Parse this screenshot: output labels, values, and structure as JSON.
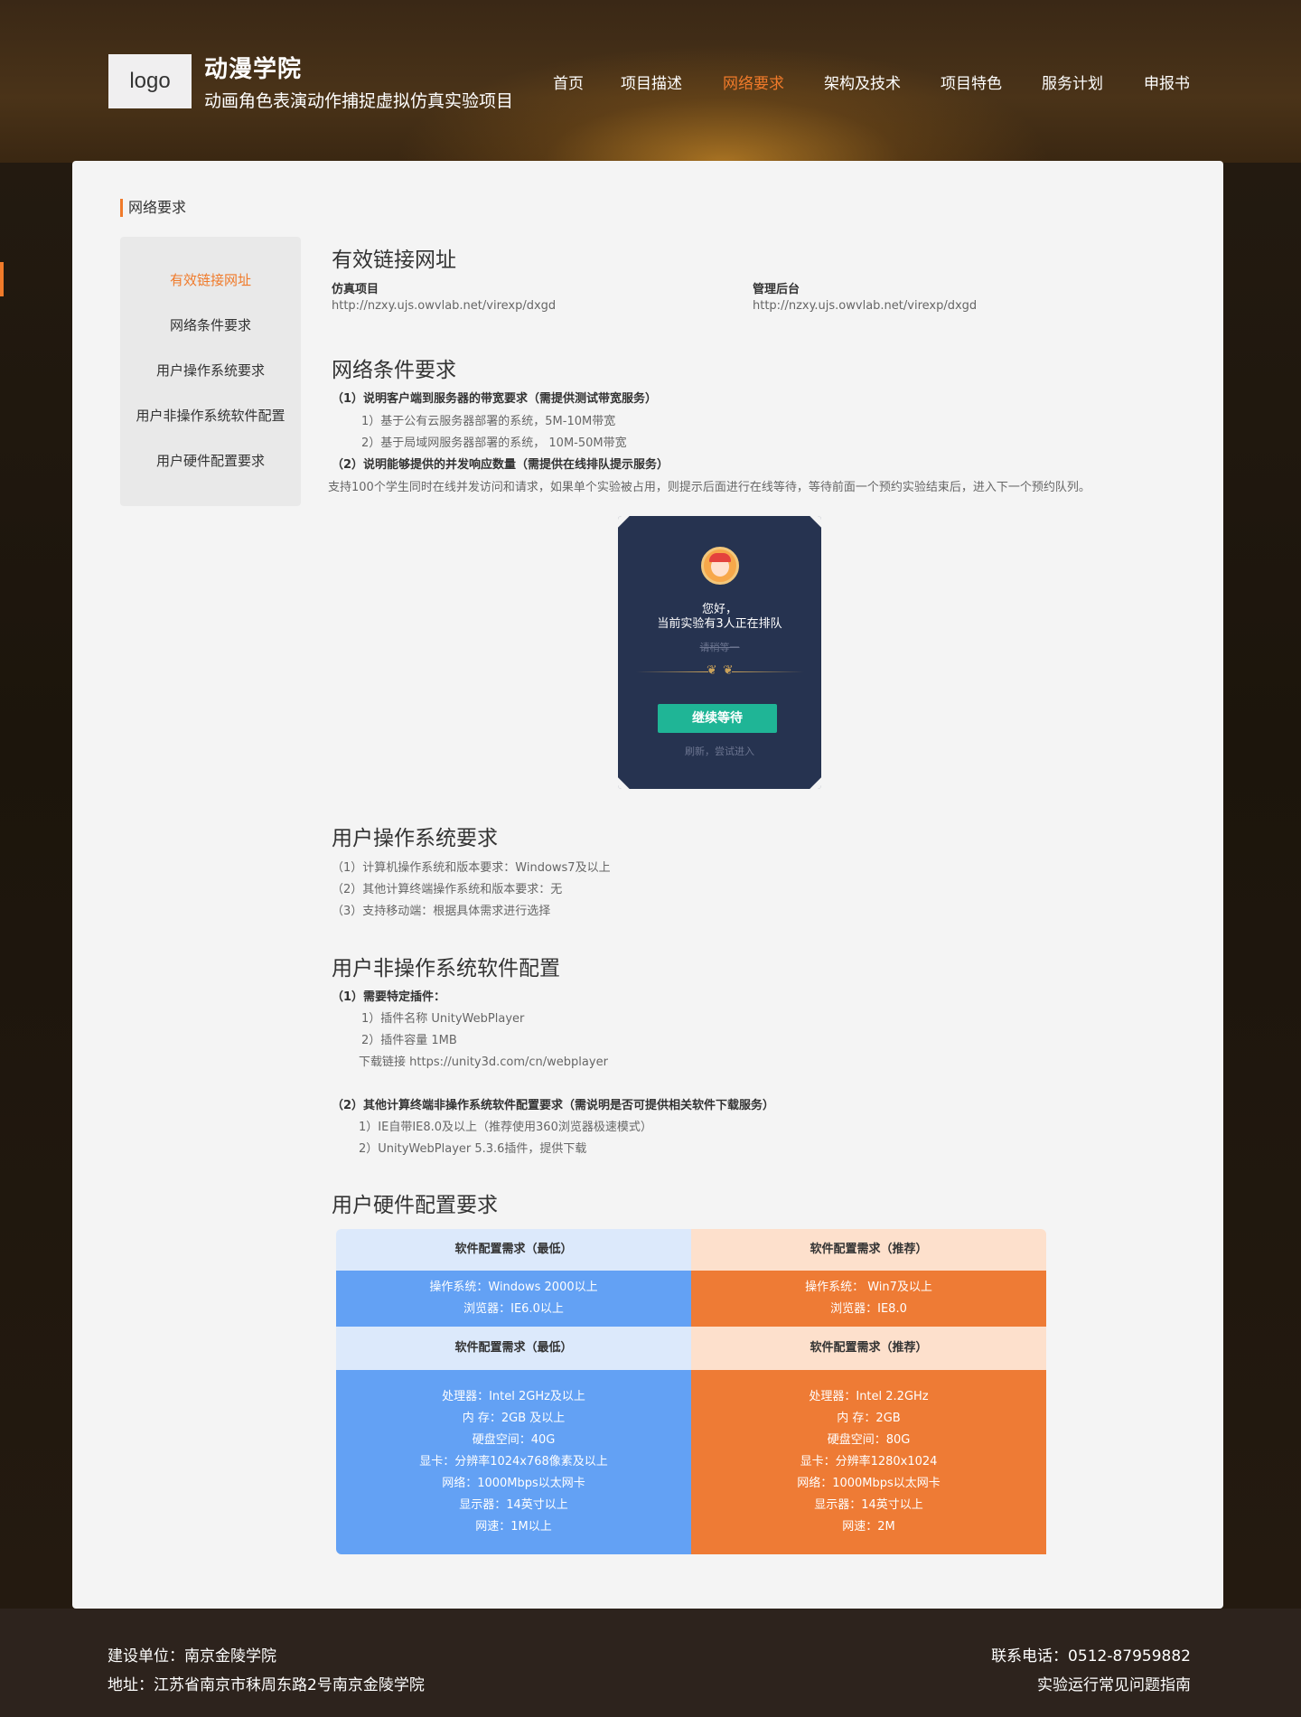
{
  "header": {
    "logo_text": "logo",
    "brand_title": "动漫学院",
    "brand_subtitle": "动画角色表演动作捕捉虚拟仿真实验项目",
    "nav": [
      {
        "label": "首页"
      },
      {
        "label": "项目描述"
      },
      {
        "label": "网络要求",
        "active": true
      },
      {
        "label": "架构及技术"
      },
      {
        "label": "项目特色"
      },
      {
        "label": "服务计划"
      },
      {
        "label": "申报书"
      }
    ],
    "accent_color": "#f07a2a"
  },
  "page": {
    "section_title": "网络要求"
  },
  "sidebar": {
    "items": [
      {
        "label": "有效链接网址",
        "active": true
      },
      {
        "label": "网络条件要求"
      },
      {
        "label": "用户操作系统要求"
      },
      {
        "label": "用户非操作系统软件配置"
      },
      {
        "label": "用户硬件配置要求"
      }
    ]
  },
  "links": {
    "title": "有效链接网址",
    "sim_label": "仿真项目",
    "sim_url": "http://nzxy.ujs.owvlab.net/virexp/dxgd",
    "admin_label": "管理后台",
    "admin_url": "http://nzxy.ujs.owvlab.net/virexp/dxgd"
  },
  "network": {
    "title": "网络条件要求",
    "q1": "（1）说明客户端到服务器的带宽要求（需提供测试带宽服务）",
    "q1_a": "1）基于公有云服务器部署的系统，5M-10M带宽",
    "q1_b": "2）基于局域网服务器部署的系统， 10M-50M带宽",
    "q2": "（2）说明能够提供的并发响应数量（需提供在线排队提示服务）",
    "q2_text": "支持100个学生同时在线并发访问和请求，如果单个实验被占用，则提示后面进行在线等待，等待前面一个预约实验结束后，进入下一个预约队列。"
  },
  "queue_popup": {
    "greeting": "您好，",
    "message": "当前实验有3人正在排队",
    "waiting": "请稍等一",
    "button": "继续等待",
    "refresh": "刷新，尝试进入",
    "bg_color": "#263350",
    "button_color": "#1fb596"
  },
  "os": {
    "title": "用户操作系统要求",
    "line1": "（1）计算机操作系统和版本要求：Windows7及以上",
    "line2": "（2）其他计算终端操作系统和版本要求：无",
    "line3": "（3）支持移动端：根据具体需求进行选择"
  },
  "software": {
    "title": "用户非操作系统软件配置",
    "q1": "（1）需要特定插件：",
    "q1_a": "1）插件名称   UnityWebPlayer",
    "q1_b": "2）插件容量   1MB",
    "q1_c": "下载链接   https://unity3d.com/cn/webplayer",
    "q2": "（2）其他计算终端非操作系统软件配置要求（需说明是否可提供相关软件下载服务）",
    "q2_a": "1）IE自带IE8.0及以上（推荐使用360浏览器极速模式）",
    "q2_b": "2）UnityWebPlayer 5.3.6插件，提供下载"
  },
  "hardware": {
    "title": "用户硬件配置要求",
    "left_head_1": "软件配置需求（最低）",
    "right_head_1": "软件配置需求（推荐）",
    "left_body_1": [
      "操作系统：Windows 2000以上",
      "浏览器：IE6.0以上"
    ],
    "right_body_1": [
      "操作系统： Win7及以上",
      "浏览器：IE8.0"
    ],
    "left_head_2": "软件配置需求（最低）",
    "right_head_2": "软件配置需求（推荐）",
    "left_body_2": [
      "处理器：Intel 2GHz及以上",
      "内 存：2GB 及以上",
      "硬盘空间：40G",
      "显卡：分辨率1024x768像素及以上",
      "网络：1000Mbps以太网卡",
      "显示器：14英寸以上",
      "网速：1M以上"
    ],
    "right_body_2": [
      "处理器：Intel 2.2GHz",
      "内 存：2GB",
      "硬盘空间：80G",
      "显卡：分辨率1280x1024",
      "网络：1000Mbps以太网卡",
      "显示器：14英寸以上",
      "网速：2M"
    ],
    "min_color": "#63a1f4",
    "rec_color": "#ee7b35"
  },
  "footer": {
    "unit": "建设单位：南京金陵学院",
    "address": "地址：江苏省南京市秣周东路2号南京金陵学院",
    "phone": "联系电话：0512-87959882",
    "faq": "实验运行常见问题指南"
  }
}
